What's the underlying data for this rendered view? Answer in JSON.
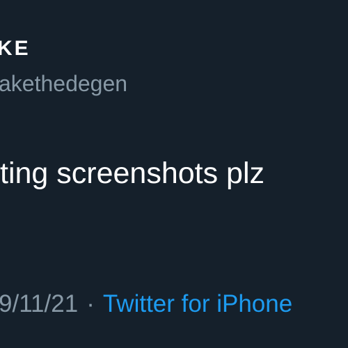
{
  "tweet": {
    "display_name": "KE",
    "handle": "akethedegen",
    "text": "ting screenshots plz",
    "date": "9/11/21",
    "separator": "·",
    "source": "Twitter for iPhone"
  },
  "colors": {
    "background": "#15202b",
    "primary_text": "#ffffff",
    "secondary_text": "#8899a6",
    "link": "#1d9bf0"
  }
}
